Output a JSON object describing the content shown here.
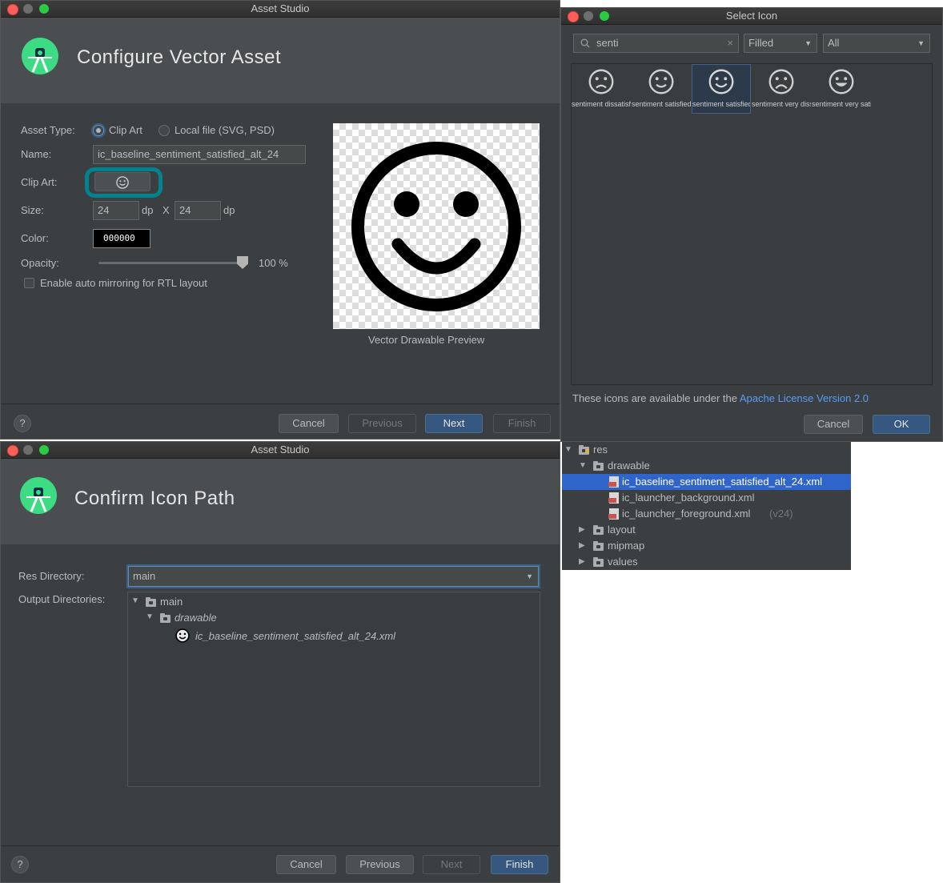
{
  "configure_window": {
    "title": "Asset Studio",
    "header_title": "Configure Vector Asset",
    "asset_type_label": "Asset Type:",
    "clip_art_option": "Clip Art",
    "local_file_option": "Local file (SVG, PSD)",
    "name_label": "Name:",
    "name_value": "ic_baseline_sentiment_satisfied_alt_24",
    "clip_art_label": "Clip Art:",
    "size_label": "Size:",
    "width_value": "24",
    "height_value": "24",
    "dp_unit": "dp",
    "x_separator": "X",
    "color_label": "Color:",
    "color_value": "000000",
    "opacity_label": "Opacity:",
    "opacity_value": "100 %",
    "opacity_fraction": 1.0,
    "rtl_label": "Enable auto mirroring for RTL layout",
    "preview_caption": "Vector Drawable Preview",
    "help_label": "?",
    "buttons": {
      "cancel": "Cancel",
      "previous": "Previous",
      "next": "Next",
      "finish": "Finish"
    }
  },
  "select_icon_window": {
    "title": "Select Icon",
    "search_value": "senti",
    "style_dropdown": "Filled",
    "category_dropdown": "All",
    "icons": [
      {
        "caption": "sentiment dissatisfied",
        "icon": "sentiment-dissatisfied-icon"
      },
      {
        "caption": "sentiment satisfied",
        "icon": "sentiment-satisfied-icon"
      },
      {
        "caption": "sentiment satisfied alt",
        "icon": "sentiment-satisfied-alt-icon",
        "selected": true
      },
      {
        "caption": "sentiment very dissatisfied",
        "icon": "sentiment-very-dissatisfied-icon"
      },
      {
        "caption": "sentiment very satisfied",
        "icon": "sentiment-very-satisfied-icon"
      }
    ],
    "license_text": "These icons are available under the",
    "license_link": "Apache License Version 2.0",
    "buttons": {
      "cancel": "Cancel",
      "ok": "OK"
    }
  },
  "confirm_window": {
    "title": "Asset Studio",
    "header_title": "Confirm Icon Path",
    "res_directory_label": "Res Directory:",
    "res_directory_value": "main",
    "output_directories_label": "Output Directories:",
    "tree": {
      "root": "main",
      "folder": "drawable",
      "file": "ic_baseline_sentiment_satisfied_alt_24.xml"
    },
    "help_label": "?",
    "buttons": {
      "cancel": "Cancel",
      "previous": "Previous",
      "next": "Next",
      "finish": "Finish"
    }
  },
  "project_tree": {
    "res": "res",
    "drawable": "drawable",
    "files": [
      {
        "name": "ic_baseline_sentiment_satisfied_alt_24.xml",
        "suffix": "",
        "selected": true
      },
      {
        "name": "ic_launcher_background.xml",
        "suffix": "",
        "selected": false
      },
      {
        "name": "ic_launcher_foreground.xml",
        "suffix": "(v24)",
        "selected": false
      }
    ],
    "folders": [
      "layout",
      "mipmap",
      "values"
    ]
  },
  "colors": {
    "dialog_bg": "#3c3f41",
    "header_bg": "#4b4e50",
    "primary_button": "#365880",
    "selection": "#2f65ca",
    "link": "#589df6",
    "highlight_ring": "#00838f"
  }
}
